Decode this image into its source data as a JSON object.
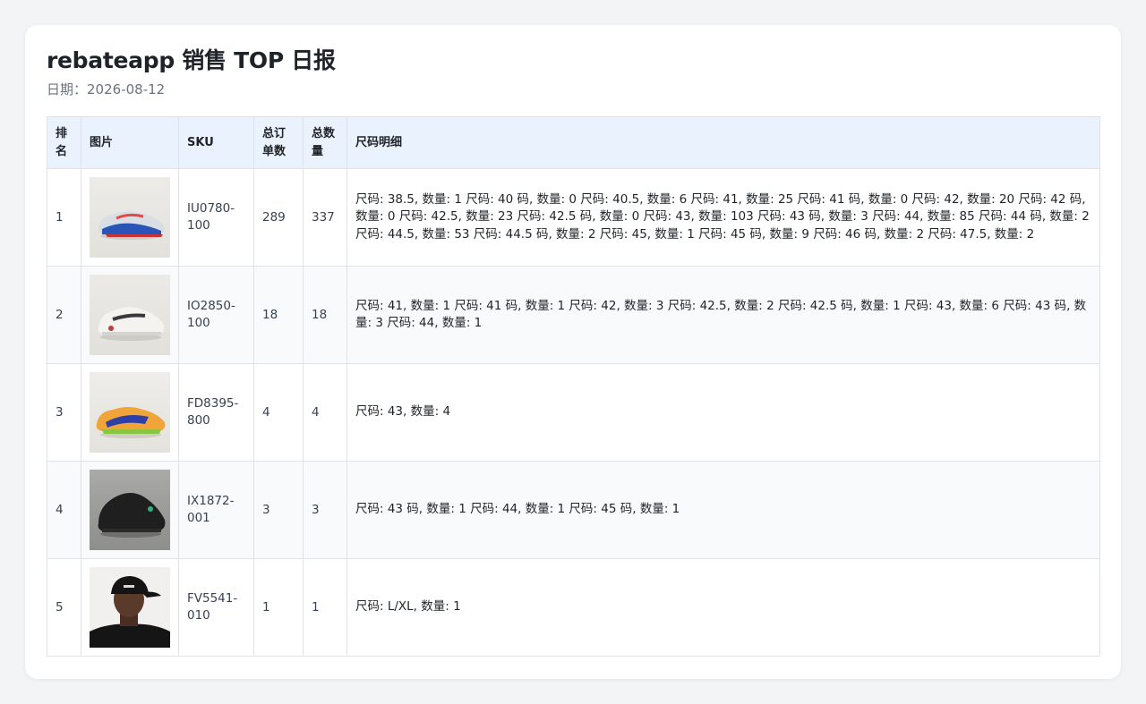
{
  "page": {
    "title": "rebateapp 销售 TOP 日报",
    "date_label": "日期：",
    "date_value": "2026-08-12"
  },
  "table": {
    "headers": {
      "rank": "排名",
      "image": "图片",
      "sku": "SKU",
      "orders": "总订单数",
      "quantity": "总数量",
      "sizes": "尺码明细"
    },
    "rows": [
      {
        "rank": "1",
        "image": "white-blue-running-shoe",
        "sku": "IU0780-100",
        "orders": "289",
        "quantity": "337",
        "sizes": "尺码: 38.5, 数量: 1 尺码: 40 码, 数量: 0 尺码: 40.5, 数量: 6 尺码: 41, 数量: 25 尺码: 41 码, 数量: 0 尺码: 42, 数量: 20 尺码: 42 码, 数量: 0 尺码: 42.5, 数量: 23 尺码: 42.5 码, 数量: 0 尺码: 43, 数量: 103 尺码: 43 码, 数量: 3 尺码: 44, 数量: 85 尺码: 44 码, 数量: 2 尺码: 44.5, 数量: 53 尺码: 44.5 码, 数量: 2 尺码: 45, 数量: 1 尺码: 45 码, 数量: 9 尺码: 46 码, 数量: 2 尺码: 47.5, 数量: 2"
      },
      {
        "rank": "2",
        "image": "white-low-sneaker",
        "sku": "IO2850-100",
        "orders": "18",
        "quantity": "18",
        "sizes": "尺码: 41, 数量: 1 尺码: 41 码, 数量: 1 尺码: 42, 数量: 3 尺码: 42.5, 数量: 2 尺码: 42.5 码, 数量: 1 尺码: 43, 数量: 6 尺码: 43 码, 数量: 3 尺码: 44, 数量: 1"
      },
      {
        "rank": "3",
        "image": "orange-track-spike",
        "sku": "FD8395-800",
        "orders": "4",
        "quantity": "4",
        "sizes": "尺码: 43, 数量: 4"
      },
      {
        "rank": "4",
        "image": "black-basketball-shoe",
        "sku": "IX1872-001",
        "orders": "3",
        "quantity": "3",
        "sizes": "尺码: 43 码, 数量: 1 尺码: 44, 数量: 1 尺码: 45 码, 数量: 1"
      },
      {
        "rank": "5",
        "image": "black-cap",
        "sku": "FV5541-010",
        "orders": "1",
        "quantity": "1",
        "sizes": "尺码: L/XL, 数量: 1"
      }
    ]
  },
  "colors": {
    "page_bg": "#f3f4f6",
    "header_bg": "#eaf2fe",
    "border": "#dfe3e8",
    "stripe": "#f9fafb"
  }
}
